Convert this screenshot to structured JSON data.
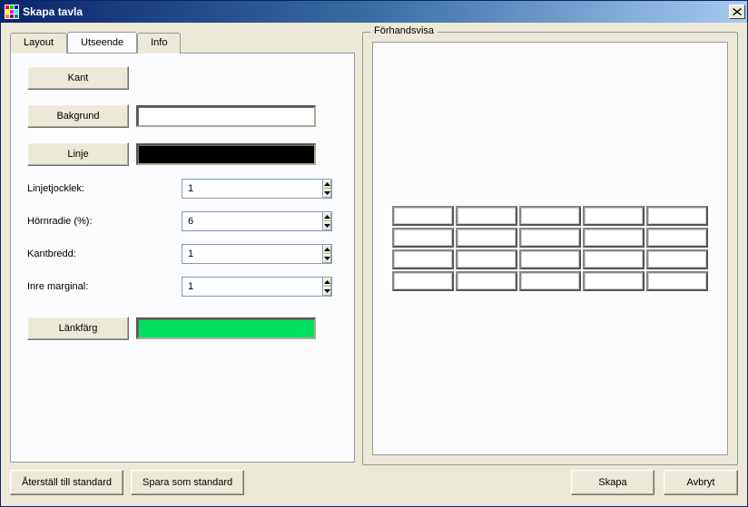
{
  "window": {
    "title": "Skapa tavla"
  },
  "tabs": {
    "layout": "Layout",
    "utseende": "Utseende",
    "info": "Info",
    "active": "utseende"
  },
  "panel": {
    "kant_btn": "Kant",
    "bakgrund_btn": "Bakgrund",
    "linje_btn": "Linje",
    "lankfarg_btn": "Länkfärg",
    "colors": {
      "bakgrund": "#FFFFFF",
      "linje": "#000000",
      "lankfarg": "#00E060"
    },
    "linjetjocklek": {
      "label": "Linjetjocklek:",
      "value": "1"
    },
    "hornradie": {
      "label": "Hörnradie (%):",
      "value": "6"
    },
    "kantbredd": {
      "label": "Kantbredd:",
      "value": "1"
    },
    "inremarginal": {
      "label": "Inre marginal:",
      "value": "1"
    }
  },
  "preview": {
    "legend": "Förhandsvisa",
    "rows": 4,
    "cols": 5
  },
  "footer": {
    "reset": "Återställ till standard",
    "save_std": "Spara som standard",
    "create": "Skapa",
    "cancel": "Avbryt"
  }
}
